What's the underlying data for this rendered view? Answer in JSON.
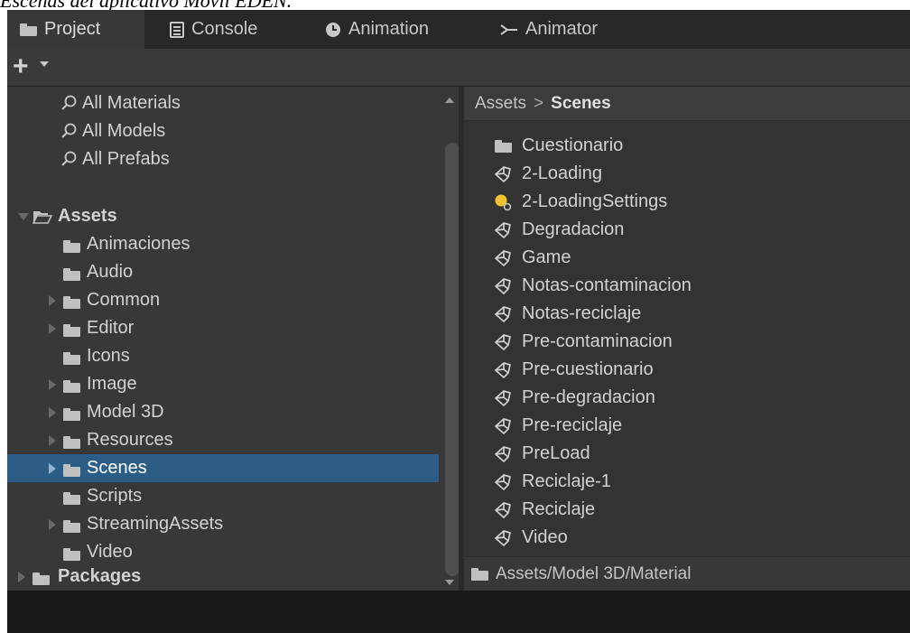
{
  "caption": "Escenas del aplicativo Movil EDEN.",
  "tabs": [
    {
      "label": "Project",
      "icon": "folder-icon",
      "active": true
    },
    {
      "label": "Console",
      "icon": "console-icon",
      "active": false
    },
    {
      "label": "Animation",
      "icon": "animation-clock-icon",
      "active": false
    },
    {
      "label": "Animator",
      "icon": "animator-icon",
      "active": false
    }
  ],
  "toolbar": {
    "create_label": "+"
  },
  "tree": {
    "favorites": [
      {
        "label": "All Materials",
        "icon": "search-icon"
      },
      {
        "label": "All Models",
        "icon": "search-icon"
      },
      {
        "label": "All Prefabs",
        "icon": "search-icon"
      }
    ],
    "assets": {
      "label": "Assets",
      "children": [
        {
          "label": "Animaciones",
          "expandable": false
        },
        {
          "label": "Audio",
          "expandable": false
        },
        {
          "label": "Common",
          "expandable": true
        },
        {
          "label": "Editor",
          "expandable": true
        },
        {
          "label": "Icons",
          "expandable": false
        },
        {
          "label": "Image",
          "expandable": true
        },
        {
          "label": "Model 3D",
          "expandable": true
        },
        {
          "label": "Resources",
          "expandable": true
        },
        {
          "label": "Scenes",
          "expandable": true,
          "selected": true
        },
        {
          "label": "Scripts",
          "expandable": false
        },
        {
          "label": "StreamingAssets",
          "expandable": true
        },
        {
          "label": "Video",
          "expandable": false
        }
      ]
    },
    "packages": {
      "label": "Packages"
    }
  },
  "breadcrumb": {
    "root": "Assets",
    "separator": ">",
    "current": "Scenes"
  },
  "files": [
    {
      "label": "Cuestionario",
      "icon": "folder-icon"
    },
    {
      "label": "2-Loading",
      "icon": "unity-scene-icon"
    },
    {
      "label": "2-LoadingSettings",
      "icon": "lighting-settings-icon"
    },
    {
      "label": "Degradacion",
      "icon": "unity-scene-icon"
    },
    {
      "label": "Game",
      "icon": "unity-scene-icon"
    },
    {
      "label": "Notas-contaminacion",
      "icon": "unity-scene-icon"
    },
    {
      "label": "Notas-reciclaje",
      "icon": "unity-scene-icon"
    },
    {
      "label": "Pre-contaminacion",
      "icon": "unity-scene-icon"
    },
    {
      "label": "Pre-cuestionario",
      "icon": "unity-scene-icon"
    },
    {
      "label": "Pre-degradacion",
      "icon": "unity-scene-icon"
    },
    {
      "label": "Pre-reciclaje",
      "icon": "unity-scene-icon"
    },
    {
      "label": "PreLoad",
      "icon": "unity-scene-icon"
    },
    {
      "label": "Reciclaje-1",
      "icon": "unity-scene-icon"
    },
    {
      "label": "Reciclaje",
      "icon": "unity-scene-icon"
    },
    {
      "label": "Video",
      "icon": "unity-scene-icon"
    }
  ],
  "status": {
    "path": "Assets/Model 3D/Material"
  },
  "colors": {
    "selection": "#2c5d87",
    "panel": "#383838",
    "text": "#d2d2d2"
  }
}
